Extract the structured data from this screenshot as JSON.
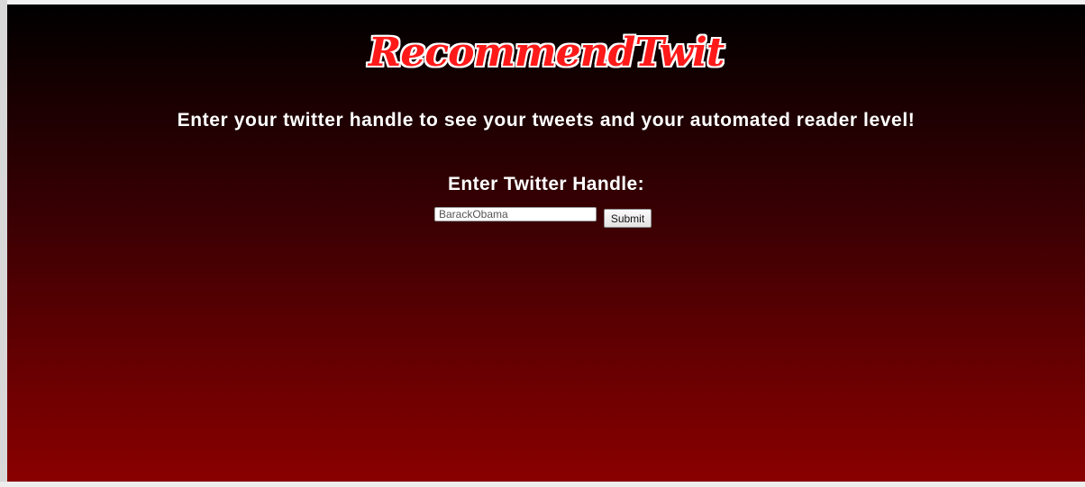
{
  "logo": {
    "text": "RecommendTwit"
  },
  "headline": "Enter your twitter handle to see your tweets and your automated reader level!",
  "form": {
    "title": "Enter Twitter Handle:",
    "input_value": "BarackObama",
    "submit_label": "Submit"
  },
  "colors": {
    "background_top": "#000000",
    "background_bottom": "#8a0000",
    "logo_fill": "#ff1a1a",
    "logo_outline": "#ffffff",
    "text": "#ffffff"
  }
}
